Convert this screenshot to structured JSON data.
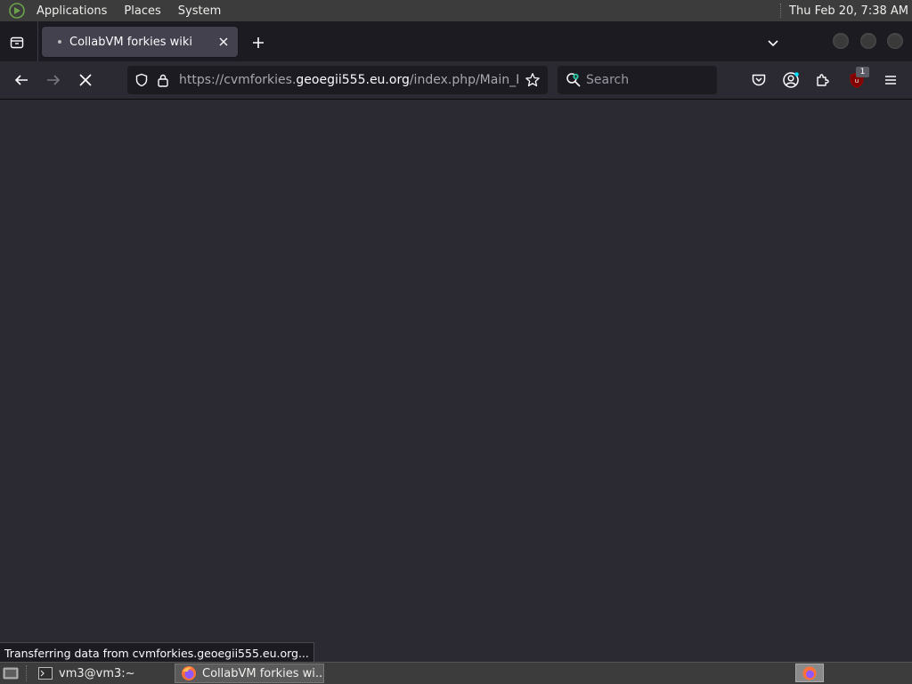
{
  "panel": {
    "menus": [
      "Applications",
      "Places",
      "System"
    ],
    "clock": "Thu Feb 20,  7:38 AM"
  },
  "browser": {
    "tab": {
      "title": "CollabVM forkies wiki"
    },
    "url": {
      "scheme": "https://",
      "host": "cvmforkies.geoegii555.eu.org",
      "host_sub": "cvmforkies.",
      "host_domain": "geoegii555.eu.org",
      "path": "/index.php/Main_Page"
    },
    "search_placeholder": "Search",
    "extension_badge": "1",
    "status_text": "Transferring data from cvmforkies.geoegii555.eu.org..."
  },
  "taskbar": {
    "tasks": [
      {
        "label": "vm3@vm3:~",
        "icon": "terminal-icon"
      },
      {
        "label": "CollabVM forkies wi...",
        "icon": "firefox-icon"
      }
    ]
  },
  "colors": {
    "accent": "#00ddff",
    "content_bg": "#2b2a33",
    "toolbar_bg": "#1c1b22",
    "panel_bg": "#3c3c3c"
  }
}
